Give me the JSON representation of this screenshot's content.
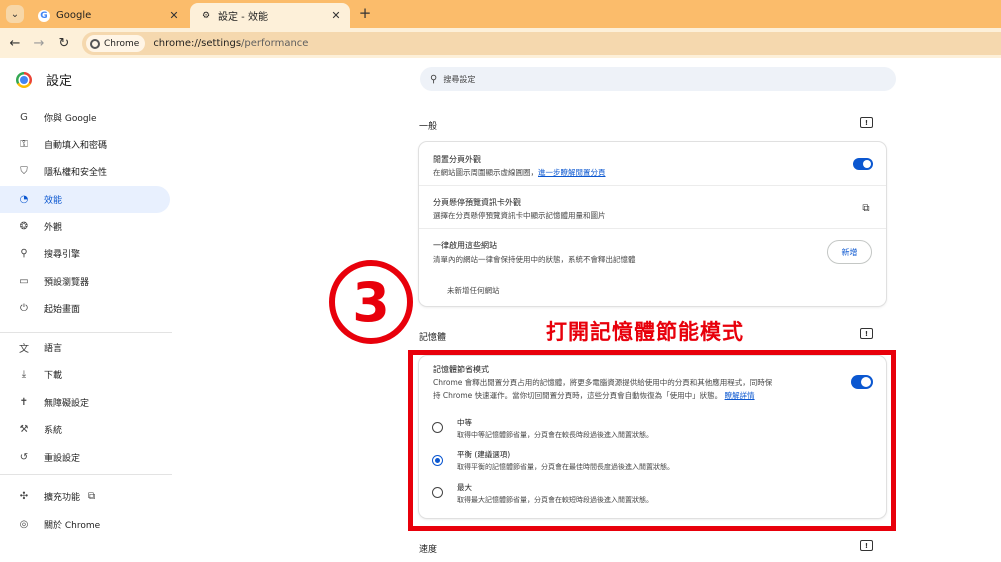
{
  "browser": {
    "tabs": [
      {
        "title": "Google",
        "active": false,
        "favicon": "google-icon"
      },
      {
        "title": "設定 - 效能",
        "active": true,
        "favicon": "gear-icon"
      }
    ],
    "omnibox": {
      "chip": "Chrome",
      "url_host": "chrome://settings",
      "url_path": "/performance"
    }
  },
  "sidebar": {
    "title": "設定",
    "items": [
      {
        "label": "你與 Google",
        "icon": "google-g-icon",
        "glyph": "G"
      },
      {
        "label": "自動填入和密碼",
        "icon": "key-icon",
        "glyph": "⚿"
      },
      {
        "label": "隱私權和安全性",
        "icon": "shield-icon",
        "glyph": "⛉"
      },
      {
        "label": "效能",
        "icon": "speedometer-icon",
        "glyph": "◔",
        "selected": true
      },
      {
        "label": "外觀",
        "icon": "palette-icon",
        "glyph": "❂"
      },
      {
        "label": "搜尋引擎",
        "icon": "search-icon",
        "glyph": "⚲"
      },
      {
        "label": "預設瀏覽器",
        "icon": "browser-window-icon",
        "glyph": "▭"
      },
      {
        "label": "起始畫面",
        "icon": "power-icon",
        "glyph": "⏻"
      },
      {
        "label": "語言",
        "icon": "translate-icon",
        "glyph": "文"
      },
      {
        "label": "下載",
        "icon": "download-icon",
        "glyph": "⤓"
      },
      {
        "label": "無障礙設定",
        "icon": "accessibility-icon",
        "glyph": "✝"
      },
      {
        "label": "系統",
        "icon": "wrench-icon",
        "glyph": "⚒"
      },
      {
        "label": "重設設定",
        "icon": "reset-icon",
        "glyph": "↺"
      },
      {
        "label": "擴充功能",
        "icon": "puzzle-icon",
        "glyph": "✣"
      },
      {
        "label": "關於 Chrome",
        "icon": "chrome-icon",
        "glyph": "◎"
      }
    ]
  },
  "search": {
    "placeholder": "搜尋設定"
  },
  "general": {
    "heading": "一般",
    "tab_hover": {
      "title": "閒置分頁外觀",
      "desc": "在網站圖示周圍顯示虛線圓圈，",
      "link": "進一步瞭解閒置分頁",
      "enabled": true
    },
    "hover_card": {
      "title": "分頁懸停預覽資訊卡外觀",
      "desc": "選擇在分頁懸停預覽資訊卡中顯示記憶體用量和圖片"
    },
    "always_active": {
      "title": "一律啟用這些網站",
      "desc": "清單內的網站一律會保持使用中的狀態，系統不會釋出記憶體",
      "add_button": "新增",
      "empty": "未新增任何網站"
    }
  },
  "memory": {
    "heading": "記憶體",
    "saver": {
      "title": "記憶體節省模式",
      "desc_line1": "Chrome 會釋出閒置分頁占用的記憶體，將更多電腦資源提供給使用中的分頁和其他應用程式，同時保",
      "desc_line2": "持 Chrome 快速運作。當你切回閒置分頁時，這些分頁會自動恢復為「使用中」狀態。",
      "link": "瞭解詳情",
      "enabled": true
    },
    "options": [
      {
        "title": "中等",
        "desc": "取得中等記憶體節省量，分頁會在較長時段過後進入閒置狀態。",
        "checked": false
      },
      {
        "title": "平衡 (建議選項)",
        "desc": "取得平衡的記憶體節省量，分頁會在最佳時間長度過後進入閒置狀態。",
        "checked": true
      },
      {
        "title": "最大",
        "desc": "取得最大記憶體節省量，分頁會在較短時段過後進入閒置狀態。",
        "checked": false
      }
    ]
  },
  "speed": {
    "heading": "速度"
  },
  "annotation": {
    "step_number": "3",
    "callout": "打開記憶體節能模式",
    "color": "#e8000b"
  }
}
